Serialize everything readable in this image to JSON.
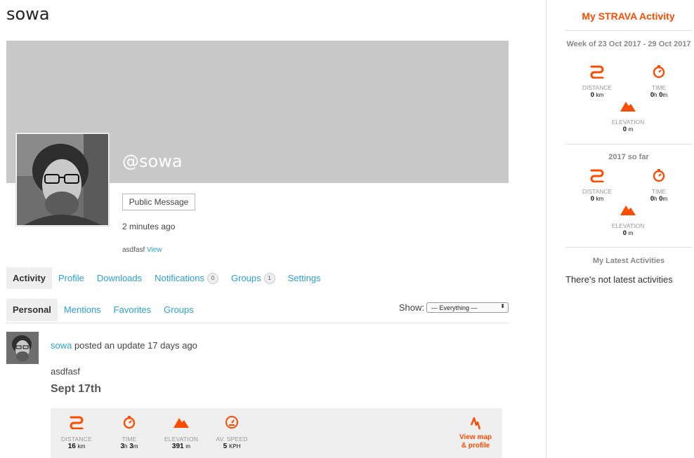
{
  "page": {
    "title": "sowa"
  },
  "profile": {
    "handle": "@sowa",
    "public_message_label": "Public Message",
    "last_active": "2 minutes ago",
    "latest_update_text": "asdfasf",
    "latest_update_link": "View"
  },
  "nav": {
    "items": [
      {
        "label": "Activity"
      },
      {
        "label": "Profile"
      },
      {
        "label": "Downloads"
      },
      {
        "label": "Notifications",
        "count": "0"
      },
      {
        "label": "Groups",
        "count": "1"
      },
      {
        "label": "Settings"
      }
    ]
  },
  "subnav": {
    "items": [
      {
        "label": "Personal"
      },
      {
        "label": "Mentions"
      },
      {
        "label": "Favorites"
      },
      {
        "label": "Groups"
      }
    ],
    "show_label": "Show:",
    "show_value": "— Everything —"
  },
  "feed": {
    "author": "sowa",
    "action": "posted an update 17 days ago",
    "body": "asdfasf",
    "activity_title": "Sept 17th",
    "stats": [
      {
        "label": "DISTANCE",
        "v1": "16",
        "u1": "km",
        "v2": "",
        "u2": "",
        "icon": "route-icon"
      },
      {
        "label": "TIME",
        "v1": "3",
        "u1": "h",
        "v2": "3",
        "u2": "m",
        "icon": "stopwatch-icon"
      },
      {
        "label": "ELEVATION",
        "v1": "391",
        "u1": "m",
        "v2": "",
        "u2": "",
        "icon": "mountain-icon"
      },
      {
        "label": "AV. SPEED",
        "v1": "5",
        "u1": "KPH",
        "v2": "",
        "u2": "",
        "icon": "speedometer-icon"
      }
    ],
    "view_map_line1": "View map",
    "view_map_line2": "& profile"
  },
  "sidebar": {
    "title": "My STRAVA Activity",
    "week": {
      "heading": "Week of 23 Oct 2017 - 29 Oct 2017",
      "distance_label": "DISTANCE",
      "distance_value": "0",
      "distance_unit": "km",
      "time_label": "TIME",
      "time_h": "0",
      "time_m": "0",
      "elevation_label": "ELEVATION",
      "elevation_value": "0",
      "elevation_unit": "m"
    },
    "year": {
      "heading": "2017 so far",
      "distance_label": "DISTANCE",
      "distance_value": "0",
      "distance_unit": "km",
      "time_label": "TIME",
      "time_h": "0",
      "time_m": "0",
      "elevation_label": "ELEVATION",
      "elevation_value": "0",
      "elevation_unit": "m"
    },
    "latest_heading": "My Latest Activities",
    "latest_empty": "There's not latest activities",
    "time_h_unit": "h",
    "time_m_unit": "m"
  },
  "colors": {
    "accent": "#fc4c02",
    "link": "#2a9fd8",
    "cover": "#c8c8c8"
  }
}
